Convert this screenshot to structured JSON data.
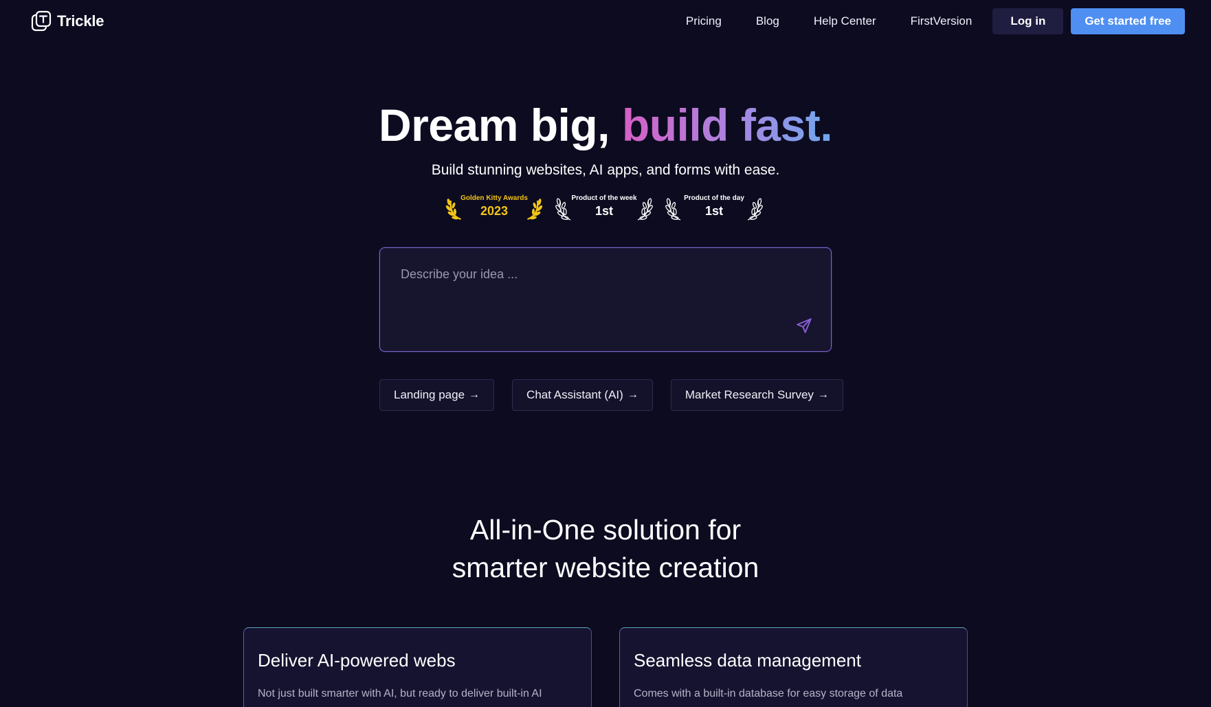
{
  "nav": {
    "brand": "Trickle",
    "links": [
      "Pricing",
      "Blog",
      "Help Center",
      "FirstVersion"
    ],
    "login_label": "Log in",
    "cta_label": "Get started free"
  },
  "hero": {
    "title_plain": "Dream big, ",
    "title_gradient": "build fast.",
    "subtitle": "Build stunning websites, AI apps, and forms with ease."
  },
  "awards": [
    {
      "label": "Golden Kitty Awards",
      "value": "2023",
      "style": "gold"
    },
    {
      "label": "Product of the week",
      "value": "1st",
      "style": "silver"
    },
    {
      "label": "Product of the day",
      "value": "1st",
      "style": "silver"
    }
  ],
  "prompt": {
    "placeholder": "Describe your idea ..."
  },
  "chips": [
    {
      "label": "Landing page",
      "arrow": "→"
    },
    {
      "label": "Chat Assistant (AI)",
      "arrow": "→"
    },
    {
      "label": "Market Research Survey",
      "arrow": "→"
    }
  ],
  "section": {
    "title_line1": "All-in-One solution for",
    "title_line2": "smarter website creation"
  },
  "cards": [
    {
      "title": "Deliver AI-powered webs",
      "text": "Not just built smarter with AI, but ready to deliver built-in AI"
    },
    {
      "title": "Seamless data management",
      "text": "Comes with a built-in database for easy storage of data"
    }
  ],
  "colors": {
    "background": "#0c0b20",
    "cta": "#4f8ff2",
    "login_bg": "#1f1d40",
    "gold": "#f2c418",
    "gradient_start": "#d65fc6",
    "gradient_end": "#6fa8ee"
  }
}
